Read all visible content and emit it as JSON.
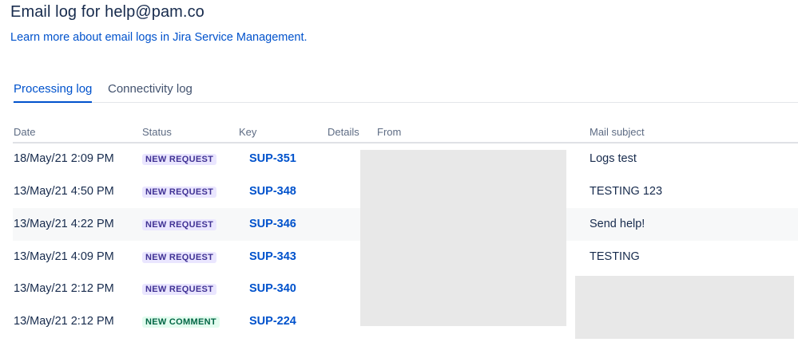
{
  "page": {
    "title": "Email log for help@pam.co",
    "learn_more": "Learn more about email logs in Jira Service Management."
  },
  "tabs": [
    {
      "label": "Processing log",
      "active": true
    },
    {
      "label": "Connectivity log",
      "active": false
    }
  ],
  "table": {
    "headers": [
      "Date",
      "Status",
      "Key",
      "Details",
      "From",
      "Mail subject"
    ],
    "rows": [
      {
        "date": "18/May/21 2:09 PM",
        "status": "NEW REQUEST",
        "key": "SUP-351",
        "subject": "Logs test"
      },
      {
        "date": "13/May/21 4:50 PM",
        "status": "NEW REQUEST",
        "key": "SUP-348",
        "subject": "TESTING 123"
      },
      {
        "date": "13/May/21 4:22 PM",
        "status": "NEW REQUEST",
        "key": "SUP-346",
        "subject": "Send help!"
      },
      {
        "date": "13/May/21 4:09 PM",
        "status": "NEW REQUEST",
        "key": "SUP-343",
        "subject": "TESTING"
      },
      {
        "date": "13/May/21 2:12 PM",
        "status": "NEW REQUEST",
        "key": "SUP-340",
        "subject": ""
      },
      {
        "date": "13/May/21 2:12 PM",
        "status": "NEW COMMENT",
        "key": "SUP-224",
        "subject": ""
      }
    ]
  },
  "colors": {
    "link": "#0052cc",
    "new_request_bg": "#eae6ff",
    "new_request_fg": "#403294",
    "new_comment_bg": "#e3fcef",
    "new_comment_fg": "#006644"
  }
}
